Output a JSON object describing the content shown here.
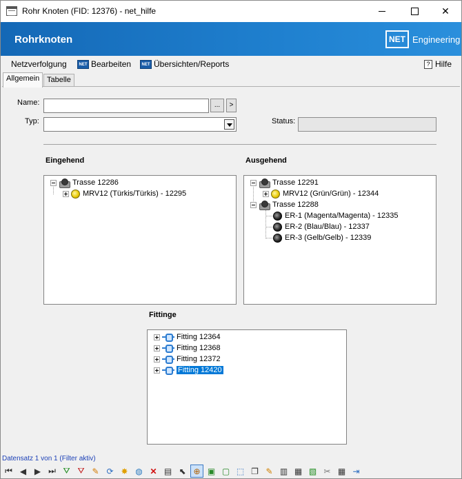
{
  "window": {
    "title": "Rohr Knoten (FID: 12376) - net_hilfe"
  },
  "banner": {
    "app_name": "Rohrknoten",
    "brand_box": "NET",
    "brand_text": "Engineering"
  },
  "menu": {
    "netzverfolgung": "Netzverfolgung",
    "bearbeiten": "Bearbeiten",
    "uebersichten": "Übersichten/Reports",
    "hilfe": "Hilfe",
    "net_icon_text": "NET",
    "help_icon_text": "?"
  },
  "tabs": [
    {
      "label": "Allgemein"
    },
    {
      "label": "Tabelle"
    }
  ],
  "form": {
    "name_label": "Name:",
    "name_value": "",
    "browse_label": "...",
    "go_label": ">",
    "typ_label": "Typ:",
    "typ_value": "",
    "status_label": "Status:",
    "status_value": ""
  },
  "eingehend": {
    "title": "Eingehend",
    "nodes": [
      {
        "label": "Trasse 12286"
      },
      {
        "label": "MRV12 (Türkis/Türkis) - 12295"
      }
    ]
  },
  "ausgehend": {
    "title": "Ausgehend",
    "nodes": [
      {
        "label": "Trasse 12291"
      },
      {
        "label": "MRV12 (Grün/Grün) - 12344"
      },
      {
        "label": "Trasse 12288"
      },
      {
        "label": "ER-1 (Magenta/Magenta) - 12335"
      },
      {
        "label": "ER-2 (Blau/Blau) - 12337"
      },
      {
        "label": "ER-3 (Gelb/Gelb) - 12339"
      }
    ]
  },
  "fittinge": {
    "title": "Fittinge",
    "nodes": [
      {
        "label": "Fitting 12364"
      },
      {
        "label": "Fitting 12368"
      },
      {
        "label": "Fitting 12372"
      },
      {
        "label": "Fitting 12420",
        "selected": true
      }
    ]
  },
  "status_line": "Datensatz 1 von 1 (Filter aktiv)",
  "toolbar": {
    "first": "⏮",
    "prev": "◀",
    "next": "▶",
    "last": "⏭",
    "filter_add": "⛛",
    "filter_remove": "⛛",
    "edit": "✎",
    "refresh": "⟳",
    "new": "✸",
    "globe": "◍",
    "delete": "✕",
    "print": "▤",
    "select": "⬉",
    "zoom": "⊕",
    "layer1": "▣",
    "layer2": "▢",
    "layer3": "⬚",
    "copy": "❐",
    "note": "✎",
    "report1": "▥",
    "report2": "▦",
    "report3": "▧",
    "cut": "✂",
    "table": "▦",
    "export": "⇥"
  },
  "colors": {
    "banner_start": "#1468b6",
    "banner_end": "#2a8fdc",
    "selection": "#0078d7",
    "status_text": "#1a3fb6"
  }
}
